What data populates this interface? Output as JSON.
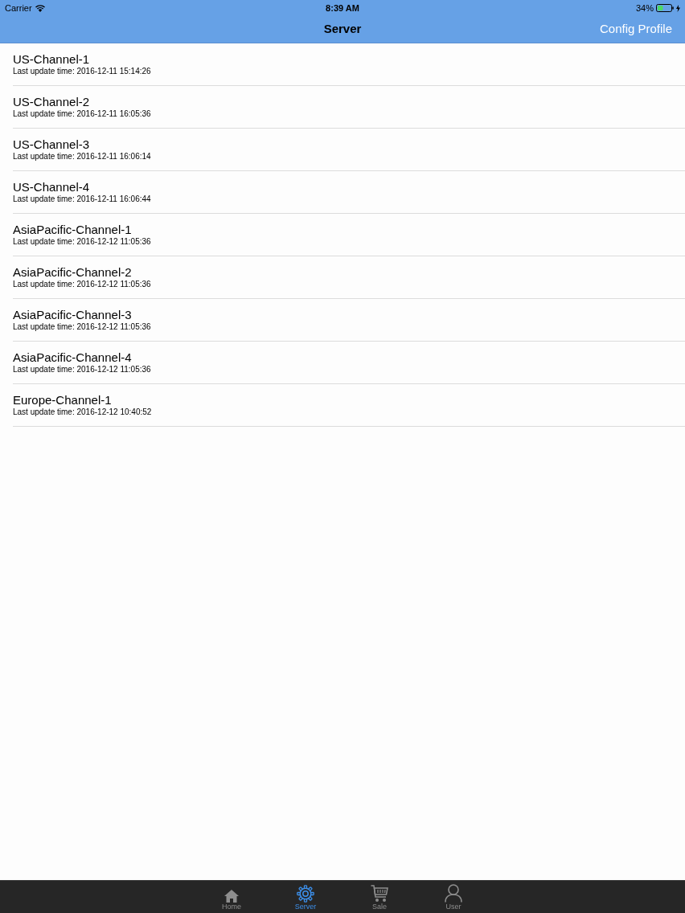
{
  "status_bar": {
    "carrier": "Carrier",
    "time": "8:39 AM",
    "battery": "34%",
    "charging": true
  },
  "nav_bar": {
    "title": "Server",
    "right_button": "Config Profile"
  },
  "servers": [
    {
      "name": "US-Channel-1",
      "detail": "Last update time: 2016-12-11 15:14:26"
    },
    {
      "name": "US-Channel-2",
      "detail": "Last update time: 2016-12-11 16:05:36"
    },
    {
      "name": "US-Channel-3",
      "detail": "Last update time: 2016-12-11 16:06:14"
    },
    {
      "name": "US-Channel-4",
      "detail": "Last update time: 2016-12-11 16:06:44"
    },
    {
      "name": "AsiaPacific-Channel-1",
      "detail": "Last update time: 2016-12-12 11:05:36"
    },
    {
      "name": "AsiaPacific-Channel-2",
      "detail": "Last update time: 2016-12-12 11:05:36"
    },
    {
      "name": "AsiaPacific-Channel-3",
      "detail": "Last update time: 2016-12-12 11:05:36"
    },
    {
      "name": "AsiaPacific-Channel-4",
      "detail": "Last update time: 2016-12-12 11:05:36"
    },
    {
      "name": "Europe-Channel-1",
      "detail": "Last update time: 2016-12-12 10:40:52"
    }
  ],
  "tab_bar": [
    {
      "kind": "home",
      "label": "Home",
      "selected": false
    },
    {
      "kind": "gear",
      "label": "Server",
      "selected": true
    },
    {
      "kind": "cart",
      "label": "Sale",
      "selected": false
    },
    {
      "kind": "person",
      "label": "User",
      "selected": false
    }
  ]
}
